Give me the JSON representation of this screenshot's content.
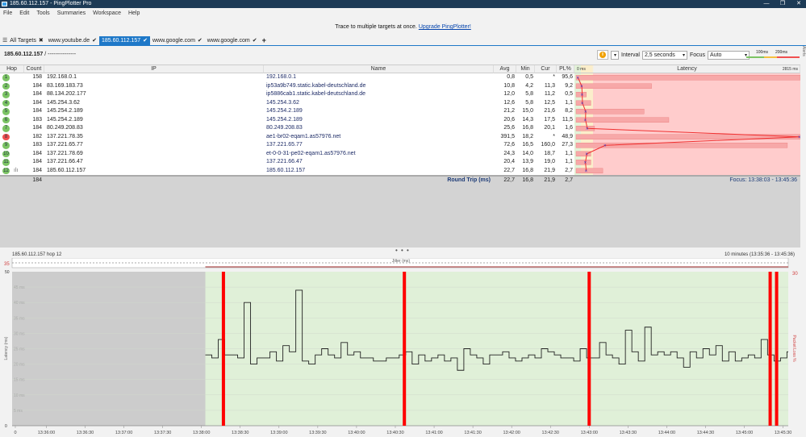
{
  "window": {
    "title": "185.60.112.157 - PingPlotter Pro",
    "minimize": "—",
    "maximize": "❐",
    "close": "✕"
  },
  "menu": [
    "File",
    "Edit",
    "Tools",
    "Summaries",
    "Workspace",
    "Help"
  ],
  "banner": {
    "text": "Trace to multiple targets at once.",
    "link": "Upgrade PingPlotter!"
  },
  "tabs": [
    {
      "label": "All Targets",
      "icon": "list-icon",
      "mark": "✖"
    },
    {
      "label": "www.youtube.de",
      "mark": "✔"
    },
    {
      "label": "185.60.112.157",
      "mark": "✔",
      "active": true
    },
    {
      "label": "www.google.com",
      "mark": "✔"
    },
    {
      "label": "www.google.com",
      "mark": "✔"
    }
  ],
  "add_tab": "+",
  "target": {
    "host": "185.60.112.157",
    "separator": " / ",
    "name": "---------------"
  },
  "controls": {
    "pause_icon": "pause-icon",
    "interval_label": "Interval",
    "interval_value": "2,5 seconds",
    "focus_label": "Focus",
    "focus_value": "Auto",
    "legend_100": "100ms",
    "legend_200": "200ms"
  },
  "alerts_label": "Alerts",
  "columns": {
    "hop": "Hop",
    "count": "Count",
    "ip": "IP",
    "name": "Name",
    "avg": "Avg",
    "min": "Min",
    "cur": "Cur",
    "pl": "PL%",
    "latency": "Latency",
    "lat_min": "0 ms",
    "lat_max": "2815 ms"
  },
  "hops": [
    {
      "hop": "1",
      "count": "158",
      "ip": "192.168.0.1",
      "name": "192.168.0.1",
      "avg": "0,8",
      "min": "0,5",
      "cur": "*",
      "pl": "95,6",
      "status": "green"
    },
    {
      "hop": "2",
      "count": "184",
      "ip": "83.169.183.73",
      "name": "ip53a9b749.static.kabel-deutschland.de",
      "avg": "10,8",
      "min": "4,2",
      "cur": "11,3",
      "pl": "9,2",
      "status": "green"
    },
    {
      "hop": "3",
      "count": "184",
      "ip": "88.134.202.177",
      "name": "ip5886cab1.static.kabel-deutschland.de",
      "avg": "12,0",
      "min": "5,8",
      "cur": "11,2",
      "pl": "0,5",
      "status": "green"
    },
    {
      "hop": "4",
      "count": "184",
      "ip": "145.254.3.62",
      "name": "145.254.3.62",
      "avg": "12,6",
      "min": "5,8",
      "cur": "12,5",
      "pl": "1,1",
      "status": "green"
    },
    {
      "hop": "5",
      "count": "184",
      "ip": "145.254.2.189",
      "name": "145.254.2.189",
      "avg": "21,2",
      "min": "15,0",
      "cur": "21,6",
      "pl": "8,2",
      "status": "green"
    },
    {
      "hop": "6",
      "count": "183",
      "ip": "145.254.2.189",
      "name": "145.254.2.189",
      "avg": "20,6",
      "min": "14,3",
      "cur": "17,5",
      "pl": "11,5",
      "status": "green"
    },
    {
      "hop": "7",
      "count": "184",
      "ip": "80.249.208.83",
      "name": "80.249.208.83",
      "avg": "25,6",
      "min": "16,8",
      "cur": "20,1",
      "pl": "1,6",
      "status": "green"
    },
    {
      "hop": "8",
      "count": "182",
      "ip": "137.221.78.35",
      "name": "ae1-br02-eqam1.as57976.net",
      "avg": "391,5",
      "min": "18,2",
      "cur": "*",
      "pl": "48,9",
      "status": "red"
    },
    {
      "hop": "9",
      "count": "183",
      "ip": "137.221.65.77",
      "name": "137.221.65.77",
      "avg": "72,6",
      "min": "16,5",
      "cur": "160,0",
      "pl": "27,3",
      "status": "green"
    },
    {
      "hop": "10",
      "count": "184",
      "ip": "137.221.78.69",
      "name": "et-0-0-31-pe02-eqam1.as57976.net",
      "avg": "24,3",
      "min": "14,0",
      "cur": "18,7",
      "pl": "1,1",
      "status": "green"
    },
    {
      "hop": "11",
      "count": "184",
      "ip": "137.221.66.47",
      "name": "137.221.66.47",
      "avg": "20,4",
      "min": "13,9",
      "cur": "19,0",
      "pl": "1,1",
      "status": "green"
    },
    {
      "hop": "12",
      "count": "184",
      "ip": "185.60.112.157",
      "name": "185.60.112.157",
      "avg": "22,7",
      "min": "16,8",
      "cur": "21,9",
      "pl": "2,7",
      "status": "green"
    }
  ],
  "summary": {
    "count": "184",
    "label": "Round Trip (ms)",
    "avg": "22,7",
    "min": "16,8",
    "cur": "21,9",
    "pl": "2,7",
    "focus": "Focus: 13:38:03 - 13:45:36"
  },
  "splitter": "• • •",
  "colors": {
    "accent": "#1e78c8",
    "good": "#7cc464",
    "bad": "#f05050",
    "loss": "#ff0000",
    "plot_bg": "#e0f0d8",
    "no_data": "#cccccc"
  },
  "chart_data": {
    "type": "line",
    "title": "185.60.112.157 hop 12",
    "range_label": "10 minutes (13:35:36 - 13:45:36)",
    "jitter_label": "Jitter (ms)",
    "jitter_max": "35",
    "ylabel": "Latency (ms)",
    "y2label": "Packet Loss %",
    "ylim": [
      0,
      50
    ],
    "y2lim": [
      0,
      30
    ],
    "yticks": [
      "0",
      "5 ms",
      "10 ms",
      "15 ms",
      "20 ms",
      "25 ms",
      "30 ms",
      "35 ms",
      "40 ms",
      "45 ms",
      "50"
    ],
    "y2tick": "30",
    "xticks": [
      "0",
      "13:36:00",
      "13:36:30",
      "13:37:00",
      "13:37:30",
      "13:38:00",
      "13:38:30",
      "13:39:00",
      "13:39:30",
      "13:40:00",
      "13:40:30",
      "13:41:00",
      "13:41:30",
      "13:42:00",
      "13:42:30",
      "13:43:00",
      "13:43:30",
      "13:44:00",
      "13:44:30",
      "13:45:00",
      "13:45:30"
    ],
    "x_start": "13:35:36",
    "x_end": "13:45:36",
    "data_start": "13:38:03",
    "sample_interval_s": 5,
    "latency_ms": [
      23,
      22,
      28,
      23,
      23,
      22,
      40,
      20,
      22,
      22,
      24,
      21,
      26,
      24,
      44,
      21,
      20,
      23,
      25,
      23,
      22,
      27,
      23,
      24,
      22,
      22,
      21,
      21,
      22,
      22,
      23,
      24,
      20,
      23,
      21,
      22,
      23,
      21,
      22,
      18,
      25,
      23,
      22,
      20,
      23,
      23,
      24,
      22,
      21,
      22,
      23,
      22,
      25,
      24,
      23,
      22,
      22,
      21,
      25,
      22,
      22,
      27,
      23,
      22,
      20,
      31,
      24,
      21,
      32,
      23,
      24,
      23,
      24,
      22,
      19,
      24,
      22,
      25,
      23,
      26,
      21,
      24,
      21,
      22,
      23,
      22,
      28,
      23,
      21,
      22,
      24,
      22,
      23,
      21,
      20,
      21,
      22,
      21,
      22,
      21,
      21,
      22,
      23,
      25,
      22,
      20,
      22,
      33,
      22,
      22,
      22,
      22,
      23
    ],
    "loss_times": [
      "13:38:17",
      "13:40:37",
      "13:43:00",
      "13:45:20",
      "13:45:25"
    ]
  }
}
